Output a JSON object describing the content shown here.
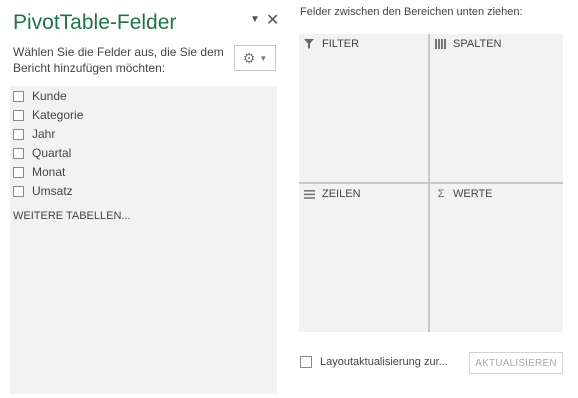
{
  "pane": {
    "title": "PivotTable-Felder",
    "description": "Wählen Sie die Felder aus, die Sie dem Bericht hinzufügen möchten:",
    "fields": [
      {
        "label": "Kunde",
        "checked": false
      },
      {
        "label": "Kategorie",
        "checked": false
      },
      {
        "label": "Jahr",
        "checked": false
      },
      {
        "label": "Quartal",
        "checked": false
      },
      {
        "label": "Monat",
        "checked": false
      },
      {
        "label": "Umsatz",
        "checked": false
      }
    ],
    "more_tables": "WEITERE TABELLEN..."
  },
  "areas": {
    "hint": "Felder zwischen den Bereichen unten ziehen:",
    "filter": {
      "label": "FILTER",
      "icon": "filter-icon"
    },
    "columns": {
      "label": "SPALTEN",
      "icon": "columns-icon"
    },
    "rows": {
      "label": "ZEILEN",
      "icon": "rows-icon"
    },
    "values": {
      "label": "WERTE",
      "icon": "sigma-icon"
    }
  },
  "footer": {
    "defer_update_label": "Layoutaktualisierung zur...",
    "defer_update_checked": false,
    "update_button": "AKTUALISIEREN",
    "update_enabled": false
  },
  "colors": {
    "accent": "#217346",
    "area_bg": "#f2f2f2",
    "separator": "#c8c8c8"
  }
}
